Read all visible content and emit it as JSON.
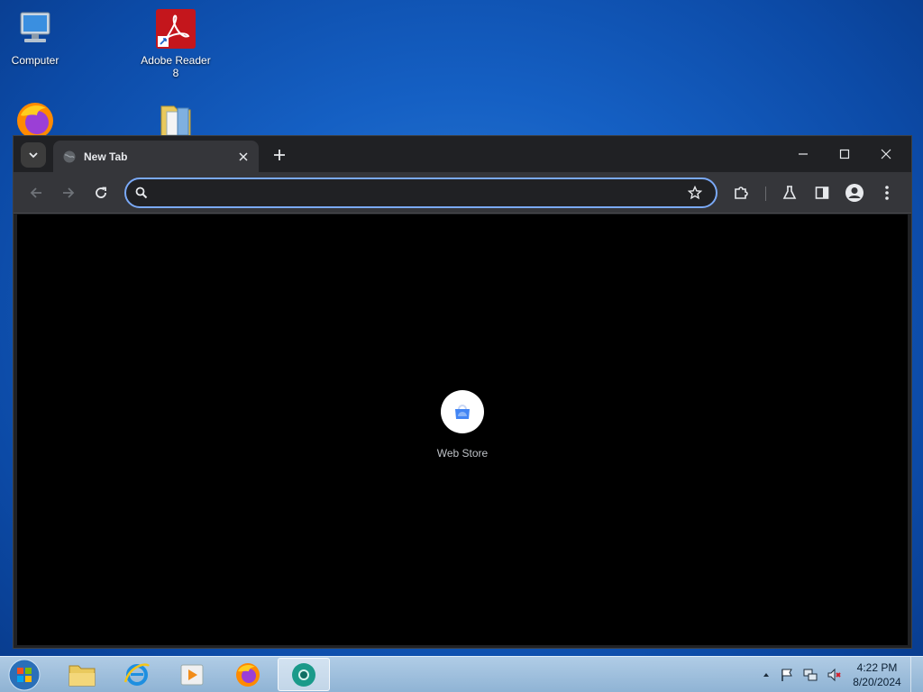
{
  "desktop": {
    "icons": [
      {
        "label": "Computer"
      },
      {
        "label": "Adobe Reader 8"
      },
      {
        "label": ""
      },
      {
        "label": ""
      }
    ]
  },
  "browser": {
    "tab": {
      "title": "New Tab"
    },
    "omnibox": {
      "value": "",
      "placeholder": ""
    },
    "shortcut": {
      "label": "Web Store"
    }
  },
  "taskbar": {
    "apps": [
      "windows-explorer",
      "internet-explorer",
      "media-player",
      "firefox",
      "chrome"
    ],
    "clock": {
      "time": "4:22 PM",
      "date": "8/20/2024"
    }
  },
  "colors": {
    "desktop_blue": "#1560c4",
    "browser_frame": "#202124",
    "toolbar": "#35363a",
    "omnibox_focus": "#7aa9f7",
    "content_bg": "#000000"
  }
}
